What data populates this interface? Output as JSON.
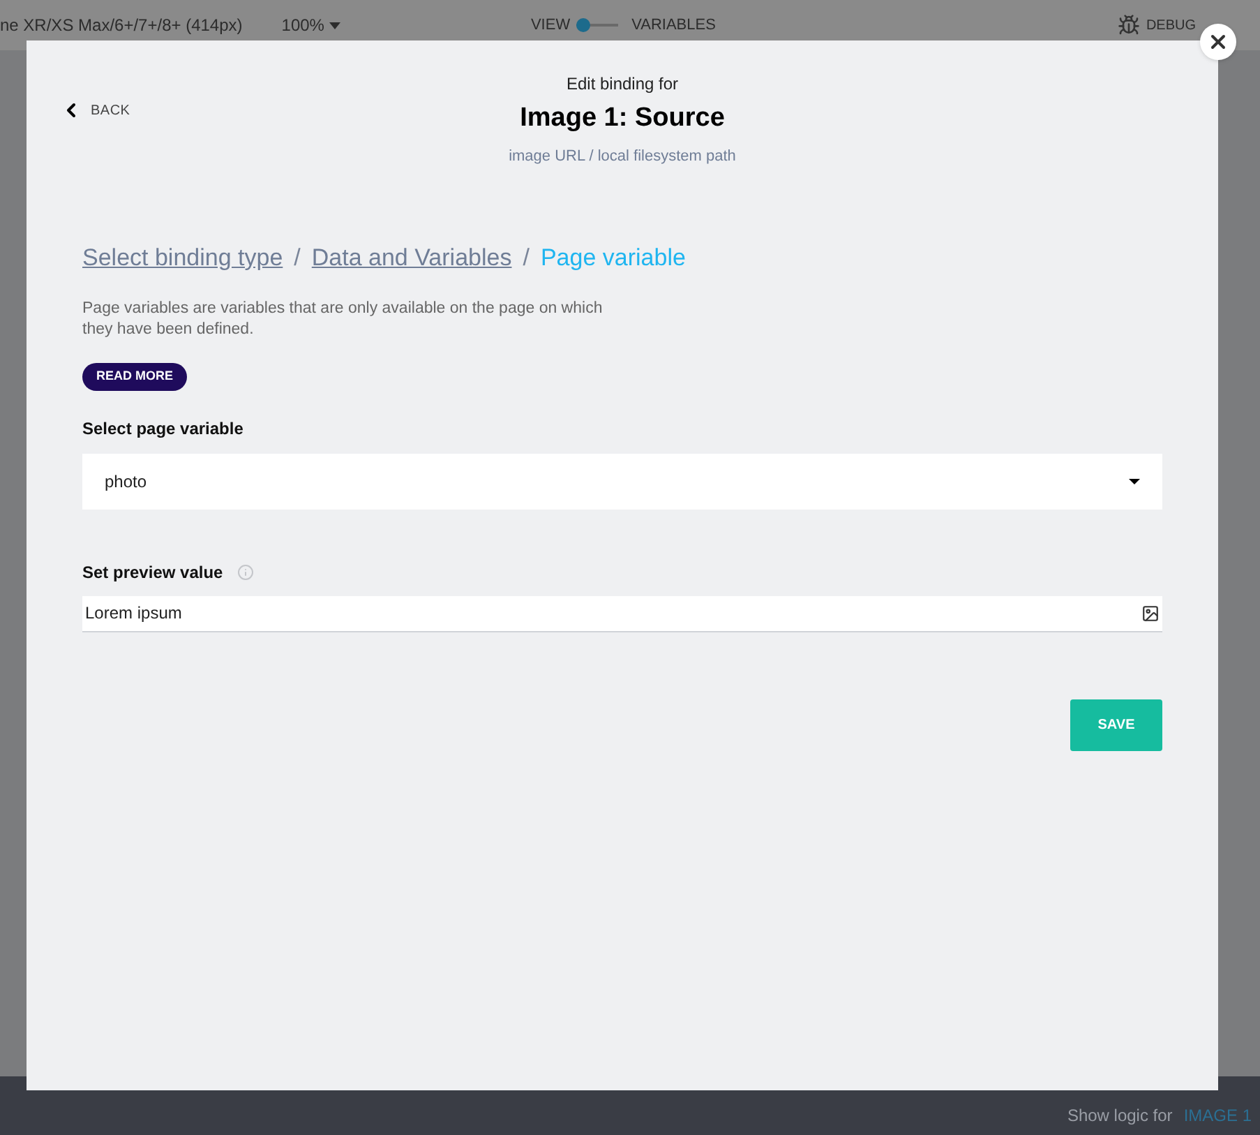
{
  "toolbar": {
    "device": "ne XR/XS Max/6+/7+/8+ (414px)",
    "zoom": "100%",
    "toggle": {
      "left_label": "VIEW",
      "right_label": "VARIABLES",
      "on": false
    },
    "debug_label": "DEBUG"
  },
  "dialog": {
    "back": "BACK",
    "subtitle": "Edit binding for",
    "title": "Image 1: Source",
    "hint": "image URL / local filesystem path",
    "breadcrumbs": [
      {
        "label": "Select binding type",
        "selected": false
      },
      {
        "label": "Data and Variables",
        "selected": false
      },
      {
        "label": "Page variable",
        "selected": true
      }
    ],
    "separator": "/",
    "description": "Page variables are variables that are only available on the page on which they have been defined.",
    "read_more": "READ MORE",
    "select_label": "Select page variable",
    "select_value": "photo",
    "preview_label": "Set preview value",
    "preview_value": "Lorem ipsum",
    "save": "SAVE"
  },
  "footer": {
    "label": "Show logic for",
    "target": "IMAGE 1"
  }
}
